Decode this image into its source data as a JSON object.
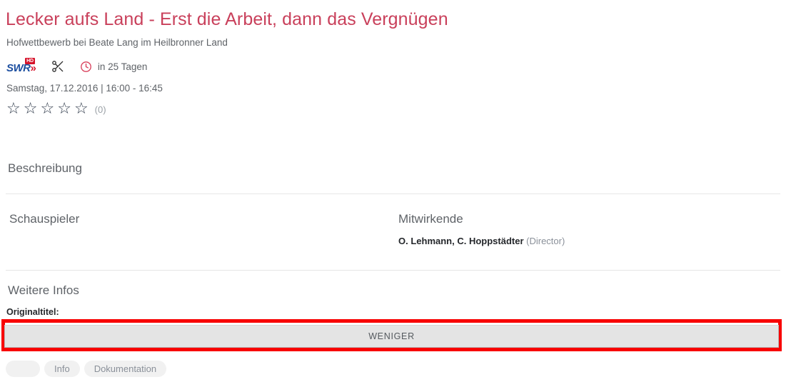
{
  "header": {
    "title": "Lecker aufs Land - Erst die Arbeit, dann das Vergnügen",
    "subtitle": "Hofwettbewerb bei Beate Lang im Heilbronner Land",
    "title_color": "#c9405b"
  },
  "meta": {
    "channel_logo_text": "SWR",
    "channel_logo_arrows": "»",
    "channel_quality_badge": "HD",
    "scissors_icon": "scissors-icon",
    "clock_icon": "clock-icon",
    "countdown": "in 25 Tagen",
    "broadcast": "Samstag, 17.12.2016 | 16:00 - 16:45"
  },
  "rating": {
    "stars": [
      "☆",
      "☆",
      "☆",
      "☆",
      "☆"
    ],
    "count": "(0)"
  },
  "sections": {
    "beschreibung": "Beschreibung",
    "schauspieler": "Schauspieler",
    "mitwirkende": "Mitwirkende",
    "weitere_infos": "Weitere Infos"
  },
  "credits": {
    "names": "O. Lehmann, C. Hoppstädter",
    "role": "(Director)"
  },
  "weitere": {
    "originaltitel_label": "Originaltitel:"
  },
  "actions": {
    "toggle_label": "WENIGER",
    "highlight_color": "#f80000"
  },
  "tags": [
    {
      "label": ""
    },
    {
      "label": "Info"
    },
    {
      "label": "Dokumentation"
    }
  ]
}
